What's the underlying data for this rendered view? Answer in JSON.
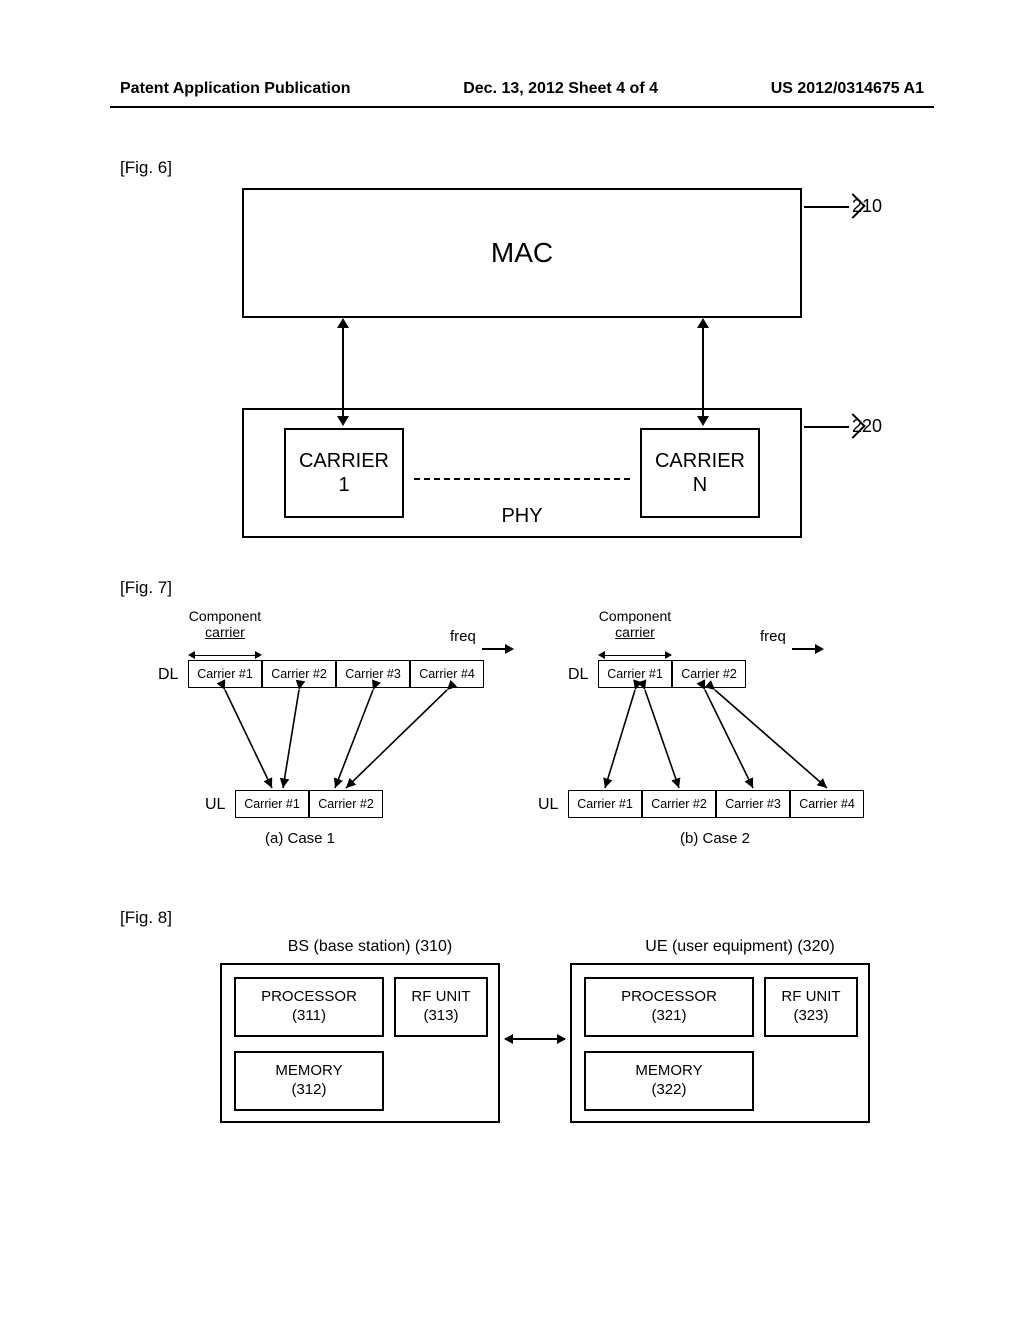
{
  "header": {
    "left": "Patent Application Publication",
    "mid": "Dec. 13, 2012  Sheet 4 of 4",
    "right": "US 2012/0314675 A1"
  },
  "fig6": {
    "label": "[Fig. 6]",
    "mac": "MAC",
    "phy": "PHY",
    "carrier1_line1": "CARRIER",
    "carrier1_line2": "1",
    "carrierN_line1": "CARRIER",
    "carrierN_line2": "N",
    "ref210": "210",
    "ref220": "220"
  },
  "fig7": {
    "label": "[Fig. 7]",
    "cc_hdr1": "Component",
    "cc_hdr2": "carrier",
    "freq": "freq",
    "dl": "DL",
    "ul": "UL",
    "case1_dl": [
      "Carrier #1",
      "Carrier #2",
      "Carrier #3",
      "Carrier #4"
    ],
    "case1_ul": [
      "Carrier #1",
      "Carrier #2"
    ],
    "case2_dl": [
      "Carrier #1",
      "Carrier #2"
    ],
    "case2_ul": [
      "Carrier #1",
      "Carrier #2",
      "Carrier #3",
      "Carrier #4"
    ],
    "caption1": "(a) Case 1",
    "caption2": "(b) Case 2"
  },
  "fig8": {
    "label": "[Fig. 8]",
    "bs_title": "BS (base station) (310)",
    "ue_title": "UE (user equipment) (320)",
    "bs_proc": "PROCESSOR\n(311)",
    "bs_rf": "RF UNIT\n(313)",
    "bs_mem": "MEMORY\n(312)",
    "ue_proc": "PROCESSOR\n(321)",
    "ue_rf": "RF UNIT\n(323)",
    "ue_mem": "MEMORY\n(322)"
  }
}
